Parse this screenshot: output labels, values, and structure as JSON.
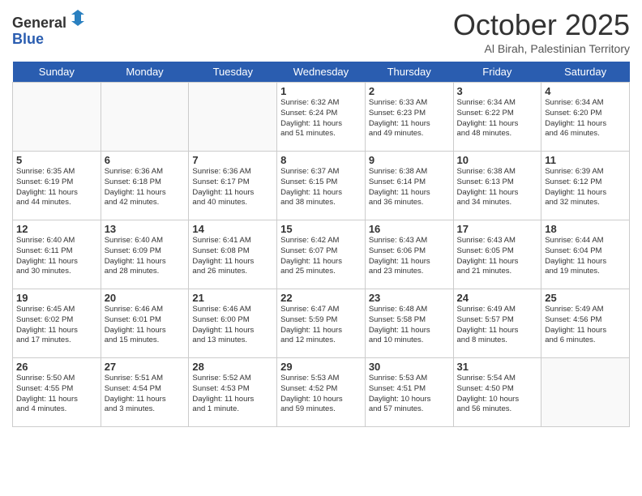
{
  "header": {
    "logo_line1": "General",
    "logo_line2": "Blue",
    "month": "October 2025",
    "location": "Al Birah, Palestinian Territory"
  },
  "weekdays": [
    "Sunday",
    "Monday",
    "Tuesday",
    "Wednesday",
    "Thursday",
    "Friday",
    "Saturday"
  ],
  "weeks": [
    [
      {
        "day": "",
        "info": ""
      },
      {
        "day": "",
        "info": ""
      },
      {
        "day": "",
        "info": ""
      },
      {
        "day": "1",
        "info": "Sunrise: 6:32 AM\nSunset: 6:24 PM\nDaylight: 11 hours\nand 51 minutes."
      },
      {
        "day": "2",
        "info": "Sunrise: 6:33 AM\nSunset: 6:23 PM\nDaylight: 11 hours\nand 49 minutes."
      },
      {
        "day": "3",
        "info": "Sunrise: 6:34 AM\nSunset: 6:22 PM\nDaylight: 11 hours\nand 48 minutes."
      },
      {
        "day": "4",
        "info": "Sunrise: 6:34 AM\nSunset: 6:20 PM\nDaylight: 11 hours\nand 46 minutes."
      }
    ],
    [
      {
        "day": "5",
        "info": "Sunrise: 6:35 AM\nSunset: 6:19 PM\nDaylight: 11 hours\nand 44 minutes."
      },
      {
        "day": "6",
        "info": "Sunrise: 6:36 AM\nSunset: 6:18 PM\nDaylight: 11 hours\nand 42 minutes."
      },
      {
        "day": "7",
        "info": "Sunrise: 6:36 AM\nSunset: 6:17 PM\nDaylight: 11 hours\nand 40 minutes."
      },
      {
        "day": "8",
        "info": "Sunrise: 6:37 AM\nSunset: 6:15 PM\nDaylight: 11 hours\nand 38 minutes."
      },
      {
        "day": "9",
        "info": "Sunrise: 6:38 AM\nSunset: 6:14 PM\nDaylight: 11 hours\nand 36 minutes."
      },
      {
        "day": "10",
        "info": "Sunrise: 6:38 AM\nSunset: 6:13 PM\nDaylight: 11 hours\nand 34 minutes."
      },
      {
        "day": "11",
        "info": "Sunrise: 6:39 AM\nSunset: 6:12 PM\nDaylight: 11 hours\nand 32 minutes."
      }
    ],
    [
      {
        "day": "12",
        "info": "Sunrise: 6:40 AM\nSunset: 6:11 PM\nDaylight: 11 hours\nand 30 minutes."
      },
      {
        "day": "13",
        "info": "Sunrise: 6:40 AM\nSunset: 6:09 PM\nDaylight: 11 hours\nand 28 minutes."
      },
      {
        "day": "14",
        "info": "Sunrise: 6:41 AM\nSunset: 6:08 PM\nDaylight: 11 hours\nand 26 minutes."
      },
      {
        "day": "15",
        "info": "Sunrise: 6:42 AM\nSunset: 6:07 PM\nDaylight: 11 hours\nand 25 minutes."
      },
      {
        "day": "16",
        "info": "Sunrise: 6:43 AM\nSunset: 6:06 PM\nDaylight: 11 hours\nand 23 minutes."
      },
      {
        "day": "17",
        "info": "Sunrise: 6:43 AM\nSunset: 6:05 PM\nDaylight: 11 hours\nand 21 minutes."
      },
      {
        "day": "18",
        "info": "Sunrise: 6:44 AM\nSunset: 6:04 PM\nDaylight: 11 hours\nand 19 minutes."
      }
    ],
    [
      {
        "day": "19",
        "info": "Sunrise: 6:45 AM\nSunset: 6:02 PM\nDaylight: 11 hours\nand 17 minutes."
      },
      {
        "day": "20",
        "info": "Sunrise: 6:46 AM\nSunset: 6:01 PM\nDaylight: 11 hours\nand 15 minutes."
      },
      {
        "day": "21",
        "info": "Sunrise: 6:46 AM\nSunset: 6:00 PM\nDaylight: 11 hours\nand 13 minutes."
      },
      {
        "day": "22",
        "info": "Sunrise: 6:47 AM\nSunset: 5:59 PM\nDaylight: 11 hours\nand 12 minutes."
      },
      {
        "day": "23",
        "info": "Sunrise: 6:48 AM\nSunset: 5:58 PM\nDaylight: 11 hours\nand 10 minutes."
      },
      {
        "day": "24",
        "info": "Sunrise: 6:49 AM\nSunset: 5:57 PM\nDaylight: 11 hours\nand 8 minutes."
      },
      {
        "day": "25",
        "info": "Sunrise: 5:49 AM\nSunset: 4:56 PM\nDaylight: 11 hours\nand 6 minutes."
      }
    ],
    [
      {
        "day": "26",
        "info": "Sunrise: 5:50 AM\nSunset: 4:55 PM\nDaylight: 11 hours\nand 4 minutes."
      },
      {
        "day": "27",
        "info": "Sunrise: 5:51 AM\nSunset: 4:54 PM\nDaylight: 11 hours\nand 3 minutes."
      },
      {
        "day": "28",
        "info": "Sunrise: 5:52 AM\nSunset: 4:53 PM\nDaylight: 11 hours\nand 1 minute."
      },
      {
        "day": "29",
        "info": "Sunrise: 5:53 AM\nSunset: 4:52 PM\nDaylight: 10 hours\nand 59 minutes."
      },
      {
        "day": "30",
        "info": "Sunrise: 5:53 AM\nSunset: 4:51 PM\nDaylight: 10 hours\nand 57 minutes."
      },
      {
        "day": "31",
        "info": "Sunrise: 5:54 AM\nSunset: 4:50 PM\nDaylight: 10 hours\nand 56 minutes."
      },
      {
        "day": "",
        "info": ""
      }
    ]
  ]
}
